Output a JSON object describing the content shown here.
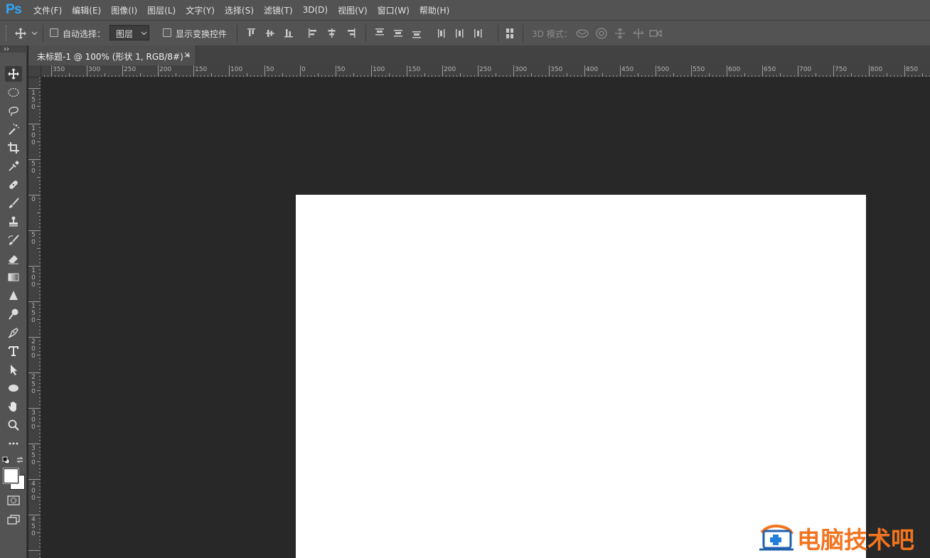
{
  "app": {
    "logo": "Ps",
    "menu": [
      "文件(F)",
      "编辑(E)",
      "图像(I)",
      "图层(L)",
      "文字(Y)",
      "选择(S)",
      "滤镜(T)",
      "3D(D)",
      "视图(V)",
      "窗口(W)",
      "帮助(H)"
    ]
  },
  "options_bar": {
    "auto_select_label": "自动选择：",
    "auto_select_checked": false,
    "layer_select_value": "图层",
    "show_transform_label": "显示变换控件",
    "show_transform_checked": false,
    "mode_3d_label": "3D 模式："
  },
  "document": {
    "tab_title": "未标题-1 @ 100% (形状 1, RGB/8#) *",
    "close_glyph": "×"
  },
  "rulers": {
    "top_labels": [
      "350",
      "300",
      "250",
      "200",
      "150",
      "100",
      "50",
      "0",
      "50",
      "100",
      "150",
      "200",
      "250",
      "300",
      "350",
      "400",
      "450",
      "500",
      "550",
      "600",
      "650",
      "700",
      "750",
      "800",
      "850"
    ],
    "left_labels": [
      "150",
      "100",
      "50",
      "0",
      "50",
      "100",
      "150",
      "200",
      "250",
      "300",
      "350",
      "400",
      "450"
    ]
  },
  "toolbar": {
    "tools": [
      "move-tool",
      "marquee-tool",
      "lasso-tool",
      "magic-wand-tool",
      "crop-tool",
      "eyedropper-tool",
      "healing-brush-tool",
      "brush-tool",
      "clone-stamp-tool",
      "history-brush-tool",
      "eraser-tool",
      "gradient-tool",
      "blur-tool",
      "dodge-tool",
      "pen-tool",
      "type-tool",
      "path-selection-tool",
      "shape-tool",
      "hand-tool",
      "zoom-tool",
      "more-tools"
    ],
    "foreground_color": "#ffffff",
    "background_color": "#ffffff"
  },
  "colors": {
    "canvas": "#ffffff",
    "workspace": "#282828",
    "chrome": "#535353",
    "brand": "#31a8ff",
    "watermark": "#f27420"
  },
  "watermark": {
    "text": "电脑技术吧"
  }
}
